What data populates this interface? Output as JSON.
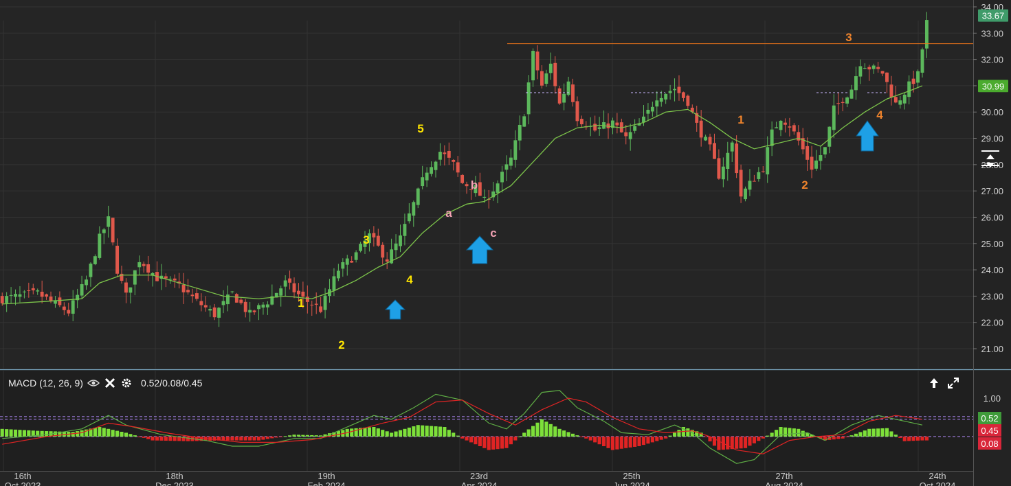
{
  "price_panel": {
    "last_price_badge": "33.67",
    "ma_badge": "30.99",
    "colors": {
      "up": "#5cb85c",
      "down": "#e0584b",
      "ma": "#7cc44a",
      "resistance": "#e8731a",
      "arrow": "#1ea0e6",
      "wave_yellow": "#ffe600",
      "wave_pink": "#f4a3b4",
      "wave_orange": "#f0842c",
      "last_badge_bg": "#3f9b6a",
      "ma_badge_bg": "#4bab2e"
    },
    "wave_labels": [
      {
        "text": "1",
        "color": "yellow"
      },
      {
        "text": "2",
        "color": "yellow"
      },
      {
        "text": "3",
        "color": "yellow"
      },
      {
        "text": "4",
        "color": "yellow"
      },
      {
        "text": "5",
        "color": "yellow"
      },
      {
        "text": "a",
        "color": "pink"
      },
      {
        "text": "b",
        "color": "pink"
      },
      {
        "text": "c",
        "color": "pink"
      },
      {
        "text": "1",
        "color": "orange"
      },
      {
        "text": "2",
        "color": "orange"
      },
      {
        "text": "3",
        "color": "orange"
      },
      {
        "text": "4",
        "color": "orange"
      }
    ]
  },
  "macd_panel": {
    "title": "MACD (12, 26, 9)",
    "values_text": "0.52/0.08/0.45",
    "badges": [
      {
        "text": "0.52",
        "bg": "#3f9b3a"
      },
      {
        "text": "0.45",
        "bg": "#d9263a"
      },
      {
        "text": "0.08",
        "bg": "#d9263a"
      }
    ],
    "colors": {
      "macd": "#5fae45",
      "signal": "#e02424",
      "hist_up": "#7de03a",
      "hist_down": "#e02424",
      "ref": "#b48cff"
    }
  },
  "chart_data": [
    {
      "type": "candlestick",
      "title": "",
      "ylim": [
        21.0,
        34.0
      ],
      "yticks": [
        "34.00",
        "33.00",
        "32.00",
        "31.00",
        "30.00",
        "29.00",
        "28.00",
        "27.00",
        "26.00",
        "25.00",
        "24.00",
        "23.00",
        "22.00",
        "21.00"
      ],
      "x_ticks": [
        {
          "day": "16th",
          "period": "Oct 2023"
        },
        {
          "day": "18th",
          "period": "Dec 2023"
        },
        {
          "day": "19th",
          "period": "Feb 2024"
        },
        {
          "day": "23rd",
          "period": "Apr 2024"
        },
        {
          "day": "25th",
          "period": "Jun 2024"
        },
        {
          "day": "27th",
          "period": "Aug 2024"
        },
        {
          "day": "24th",
          "period": "Oct 2024"
        }
      ],
      "close_path": [
        [
          0,
          22.9
        ],
        [
          8,
          23.1
        ],
        [
          15,
          22.4
        ],
        [
          19,
          23.6
        ],
        [
          22,
          25.2
        ],
        [
          24,
          25.9
        ],
        [
          26,
          24.0
        ],
        [
          28,
          23.0
        ],
        [
          31,
          24.4
        ],
        [
          35,
          23.7
        ],
        [
          40,
          23.4
        ],
        [
          44,
          22.8
        ],
        [
          48,
          22.3
        ],
        [
          52,
          23.1
        ],
        [
          56,
          22.3
        ],
        [
          60,
          22.8
        ],
        [
          64,
          23.5
        ],
        [
          68,
          22.9
        ],
        [
          72,
          22.5
        ],
        [
          76,
          24.0
        ],
        [
          80,
          24.6
        ],
        [
          83,
          25.3
        ],
        [
          87,
          24.4
        ],
        [
          90,
          25.2
        ],
        [
          93,
          26.5
        ],
        [
          96,
          27.8
        ],
        [
          99,
          28.5
        ],
        [
          102,
          28.0
        ],
        [
          104,
          27.3
        ],
        [
          107,
          27.1
        ],
        [
          109,
          26.6
        ],
        [
          112,
          27.3
        ],
        [
          115,
          28.2
        ],
        [
          118,
          30.0
        ],
        [
          120,
          32.2
        ],
        [
          122,
          31.0
        ],
        [
          124,
          31.8
        ],
        [
          126,
          30.3
        ],
        [
          128,
          31.2
        ],
        [
          130,
          29.8
        ],
        [
          134,
          29.3
        ],
        [
          138,
          29.6
        ],
        [
          141,
          29.0
        ],
        [
          145,
          29.7
        ],
        [
          148,
          30.6
        ],
        [
          152,
          30.9
        ],
        [
          155,
          30.4
        ],
        [
          157,
          29.5
        ],
        [
          160,
          28.6
        ],
        [
          162,
          27.6
        ],
        [
          165,
          28.8
        ],
        [
          167,
          26.8
        ],
        [
          170,
          27.5
        ],
        [
          172,
          27.9
        ],
        [
          174,
          29.2
        ],
        [
          176,
          29.8
        ],
        [
          178,
          29.5
        ],
        [
          180,
          28.9
        ],
        [
          183,
          27.9
        ],
        [
          186,
          28.6
        ],
        [
          188,
          30.1
        ],
        [
          190,
          30.5
        ],
        [
          192,
          30.9
        ],
        [
          194,
          31.9
        ],
        [
          196,
          31.7
        ],
        [
          199,
          31.5
        ],
        [
          202,
          30.3
        ],
        [
          205,
          31.0
        ],
        [
          207,
          31.4
        ],
        [
          209,
          33.4
        ]
      ],
      "ma_path": [
        [
          0,
          22.7
        ],
        [
          10,
          22.8
        ],
        [
          18,
          22.9
        ],
        [
          22,
          23.5
        ],
        [
          27,
          23.8
        ],
        [
          34,
          23.8
        ],
        [
          42,
          23.4
        ],
        [
          50,
          23.0
        ],
        [
          58,
          22.9
        ],
        [
          64,
          23.0
        ],
        [
          70,
          22.9
        ],
        [
          75,
          23.2
        ],
        [
          80,
          23.6
        ],
        [
          85,
          24.1
        ],
        [
          90,
          24.5
        ],
        [
          95,
          25.4
        ],
        [
          100,
          26.1
        ],
        [
          105,
          26.5
        ],
        [
          109,
          26.6
        ],
        [
          115,
          27.2
        ],
        [
          120,
          28.1
        ],
        [
          125,
          29.0
        ],
        [
          130,
          29.4
        ],
        [
          135,
          29.5
        ],
        [
          140,
          29.4
        ],
        [
          145,
          29.6
        ],
        [
          150,
          30.0
        ],
        [
          155,
          30.1
        ],
        [
          160,
          29.6
        ],
        [
          165,
          29.0
        ],
        [
          170,
          28.6
        ],
        [
          175,
          28.8
        ],
        [
          180,
          29.0
        ],
        [
          185,
          28.7
        ],
        [
          190,
          29.4
        ],
        [
          195,
          30.0
        ],
        [
          200,
          30.5
        ],
        [
          205,
          30.8
        ],
        [
          208,
          31.0
        ]
      ],
      "resistance_level": 32.6,
      "total_bars": 220
    },
    {
      "type": "line",
      "title": "MACD (12, 26, 9)",
      "yticks": [
        "1.00"
      ],
      "ylim": [
        -1.0,
        1.5
      ],
      "reference_levels": [
        0.52,
        0.45,
        0.0
      ],
      "series": [
        {
          "name": "macd",
          "points": [
            [
              0,
              -0.05
            ],
            [
              10,
              0.05
            ],
            [
              18,
              0.2
            ],
            [
              24,
              0.55
            ],
            [
              28,
              0.3
            ],
            [
              36,
              0.05
            ],
            [
              46,
              -0.1
            ],
            [
              52,
              -0.25
            ],
            [
              58,
              -0.25
            ],
            [
              66,
              -0.05
            ],
            [
              72,
              -0.05
            ],
            [
              78,
              0.25
            ],
            [
              84,
              0.55
            ],
            [
              88,
              0.45
            ],
            [
              93,
              0.75
            ],
            [
              98,
              1.1
            ],
            [
              104,
              0.95
            ],
            [
              110,
              0.35
            ],
            [
              114,
              0.2
            ],
            [
              118,
              0.6
            ],
            [
              122,
              1.15
            ],
            [
              126,
              1.2
            ],
            [
              130,
              0.75
            ],
            [
              136,
              0.4
            ],
            [
              140,
              0.1
            ],
            [
              146,
              0.05
            ],
            [
              152,
              0.3
            ],
            [
              156,
              0.1
            ],
            [
              160,
              -0.3
            ],
            [
              166,
              -0.7
            ],
            [
              170,
              -0.6
            ],
            [
              176,
              0.05
            ],
            [
              182,
              0.1
            ],
            [
              186,
              -0.1
            ],
            [
              192,
              0.3
            ],
            [
              198,
              0.55
            ],
            [
              202,
              0.45
            ],
            [
              208,
              0.3
            ]
          ]
        },
        {
          "name": "signal",
          "points": [
            [
              0,
              -0.2
            ],
            [
              10,
              0.0
            ],
            [
              18,
              0.1
            ],
            [
              24,
              0.35
            ],
            [
              30,
              0.25
            ],
            [
              38,
              0.08
            ],
            [
              46,
              -0.05
            ],
            [
              54,
              -0.15
            ],
            [
              62,
              -0.15
            ],
            [
              70,
              -0.08
            ],
            [
              78,
              0.1
            ],
            [
              86,
              0.35
            ],
            [
              92,
              0.5
            ],
            [
              98,
              0.9
            ],
            [
              104,
              0.95
            ],
            [
              110,
              0.6
            ],
            [
              116,
              0.3
            ],
            [
              122,
              0.7
            ],
            [
              128,
              1.0
            ],
            [
              132,
              0.9
            ],
            [
              138,
              0.5
            ],
            [
              144,
              0.2
            ],
            [
              150,
              0.1
            ],
            [
              156,
              0.15
            ],
            [
              160,
              0.0
            ],
            [
              166,
              -0.35
            ],
            [
              172,
              -0.45
            ],
            [
              178,
              -0.1
            ],
            [
              184,
              0.0
            ],
            [
              190,
              0.05
            ],
            [
              196,
              0.4
            ],
            [
              202,
              0.55
            ],
            [
              208,
              0.45
            ]
          ]
        },
        {
          "name": "histogram",
          "points": [
            [
              0,
              0.2
            ],
            [
              8,
              0.15
            ],
            [
              16,
              0.12
            ],
            [
              22,
              0.25
            ],
            [
              28,
              0.1
            ],
            [
              34,
              -0.1
            ],
            [
              42,
              -0.12
            ],
            [
              50,
              -0.1
            ],
            [
              58,
              -0.1
            ],
            [
              66,
              0.05
            ],
            [
              72,
              0.03
            ],
            [
              78,
              0.2
            ],
            [
              84,
              0.25
            ],
            [
              88,
              0.1
            ],
            [
              94,
              0.3
            ],
            [
              100,
              0.25
            ],
            [
              104,
              -0.05
            ],
            [
              110,
              -0.35
            ],
            [
              114,
              -0.3
            ],
            [
              118,
              0.1
            ],
            [
              122,
              0.45
            ],
            [
              126,
              0.2
            ],
            [
              132,
              -0.05
            ],
            [
              138,
              -0.35
            ],
            [
              144,
              -0.25
            ],
            [
              150,
              -0.05
            ],
            [
              154,
              0.25
            ],
            [
              158,
              0.1
            ],
            [
              162,
              -0.35
            ],
            [
              168,
              -0.3
            ],
            [
              172,
              -0.05
            ],
            [
              176,
              0.25
            ],
            [
              180,
              0.2
            ],
            [
              186,
              -0.1
            ],
            [
              190,
              -0.05
            ],
            [
              196,
              0.2
            ],
            [
              200,
              0.22
            ],
            [
              204,
              -0.12
            ],
            [
              208,
              -0.1
            ]
          ]
        }
      ]
    }
  ]
}
